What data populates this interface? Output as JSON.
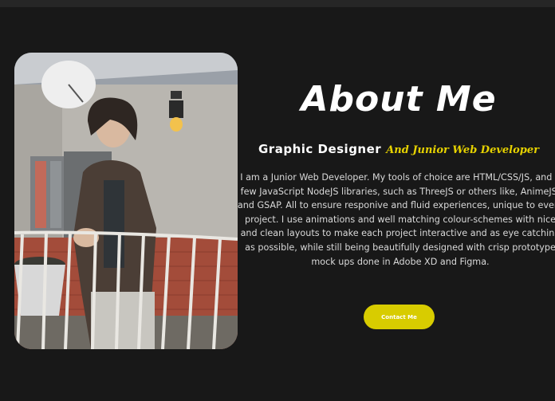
{
  "about": {
    "title": "About Me",
    "role": "Graphic Designer",
    "role_accent": "And Junior Web Developer",
    "bio": "I am a Junior Web Developer. My tools of choice are HTML/CSS/JS, and a few JavaScript NodeJS libraries, such as ThreeJS or others like, AnimeJS, and GSAP. All to ensure responive and fluid experiences, unique to every project. I use animations and well matching colour-schemes with nice and clean layouts to make each project interactive and as eye catching as possible, while still being beautifully designed with crisp prototype mock ups done in Adobe XD and Figma.",
    "contact_label": "Contact Me"
  },
  "colors": {
    "background": "#181818",
    "accent": "#d8cc00",
    "accent_text": "#e6d200",
    "text": "#ffffff"
  }
}
